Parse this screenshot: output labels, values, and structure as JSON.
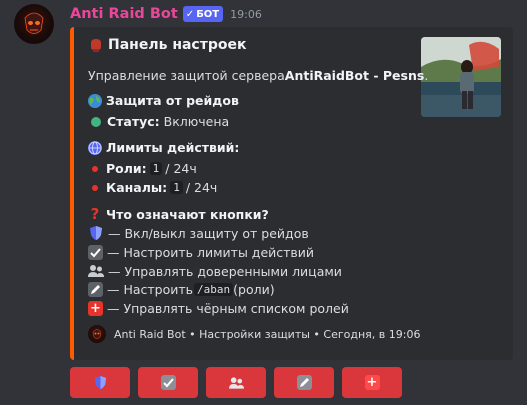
{
  "message": {
    "username": "Anti Raid Bot",
    "bot_tag": "БОТ",
    "bot_tag_check": "✓",
    "timestamp": "19:06"
  },
  "embed": {
    "accent_color": "#ff5a00",
    "title": "Панель настроек",
    "description_prefix": "Управление защитой сервера ",
    "description_server": "AntiRaidBot - Pesns",
    "description_suffix": ".",
    "protection": {
      "heading": "Защита от рейдов",
      "status_label": "Статус:",
      "status_value": "Включена"
    },
    "limits": {
      "heading": "Лимиты действий:",
      "roles_label": "Роли:",
      "roles_value": "1",
      "roles_period": "/ 24ч",
      "channels_label": "Каналы:",
      "channels_value": "1",
      "channels_period": "/ 24ч"
    },
    "buttons_help": {
      "heading": "Что означают кнопки?",
      "items": [
        "— Вкл/выкл защиту от рейдов",
        "— Настроить лимиты действий",
        "— Управлять доверенными лицами",
        "— Настроить ",
        "— Управлять чёрным списком ролей"
      ],
      "aban_code": "/aban",
      "aban_suffix": " (роли)"
    },
    "footer": "Anti Raid Bot • Настройки защиты • Сегодня, в 19:06"
  },
  "buttons": [
    {
      "icon": "shield-icon"
    },
    {
      "icon": "checkbox-icon"
    },
    {
      "icon": "users-icon"
    },
    {
      "icon": "pencil-icon"
    },
    {
      "icon": "plus-icon"
    }
  ]
}
